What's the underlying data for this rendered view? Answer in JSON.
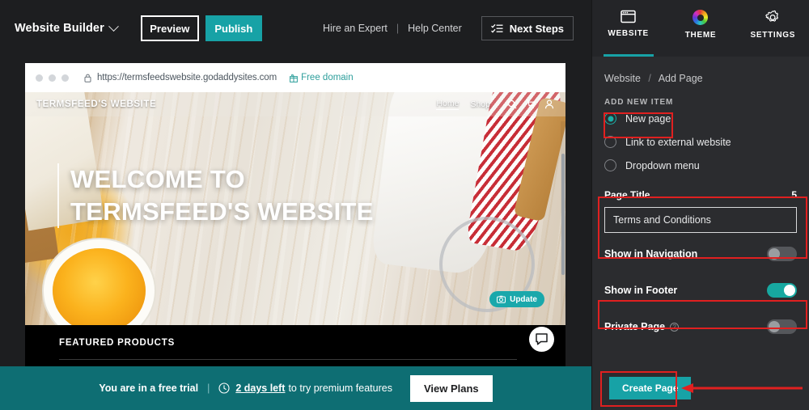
{
  "topbar": {
    "brand": "Website Builder",
    "preview_label": "Preview",
    "publish_label": "Publish",
    "hire_expert_label": "Hire an Expert",
    "divider": "|",
    "help_center_label": "Help Center",
    "next_steps_label": "Next Steps"
  },
  "browser": {
    "url": "https://termsfeedswebsite.godaddysites.com",
    "free_domain_label": "Free domain"
  },
  "site": {
    "logo": "TERMSFEED'S WEBSITE",
    "nav": [
      {
        "label": "Home",
        "active": true
      },
      {
        "label": "Shop",
        "active": false
      }
    ],
    "hero_title": "WELCOME TO TERMSFEED'S WEBSITE",
    "update_chip_label": "Update",
    "featured_title": "FEATURED PRODUCTS"
  },
  "trial": {
    "message_strong": "You are in a free trial",
    "divider": "|",
    "days_left": "2 days left",
    "message_rest": "to try premium features",
    "view_plans_label": "View Plans"
  },
  "panel": {
    "tabs": [
      {
        "label": "WEBSITE",
        "icon": "browser-window-icon",
        "active": true
      },
      {
        "label": "THEME",
        "icon": "color-wheel-icon",
        "active": false
      },
      {
        "label": "SETTINGS",
        "icon": "gear-icon",
        "active": false
      }
    ],
    "breadcrumb": {
      "root": "Website",
      "separator": "/",
      "current": "Add Page"
    },
    "section_label": "ADD NEW ITEM",
    "radios": [
      {
        "label": "New page",
        "checked": true
      },
      {
        "label": "Link to external website",
        "checked": false
      },
      {
        "label": "Dropdown menu",
        "checked": false
      }
    ],
    "page_title": {
      "label": "Page Title",
      "char_count": "5",
      "value": "Terms and Conditions",
      "placeholder": "Page Title"
    },
    "toggles": [
      {
        "label": "Show in Navigation",
        "on": false,
        "info": false
      },
      {
        "label": "Show in Footer",
        "on": true,
        "info": false
      },
      {
        "label": "Private Page",
        "on": false,
        "info": true
      }
    ],
    "create_button_label": "Create Page"
  },
  "colors": {
    "teal": "#17a2a6",
    "teal_dark": "#0e6e73",
    "toggle_on": "#17a8a0",
    "radio_on": "#19b0a8",
    "annotation_red": "#e02020",
    "panel_bg": "#2b2c2f",
    "topbar_bg": "#1d1e20"
  }
}
